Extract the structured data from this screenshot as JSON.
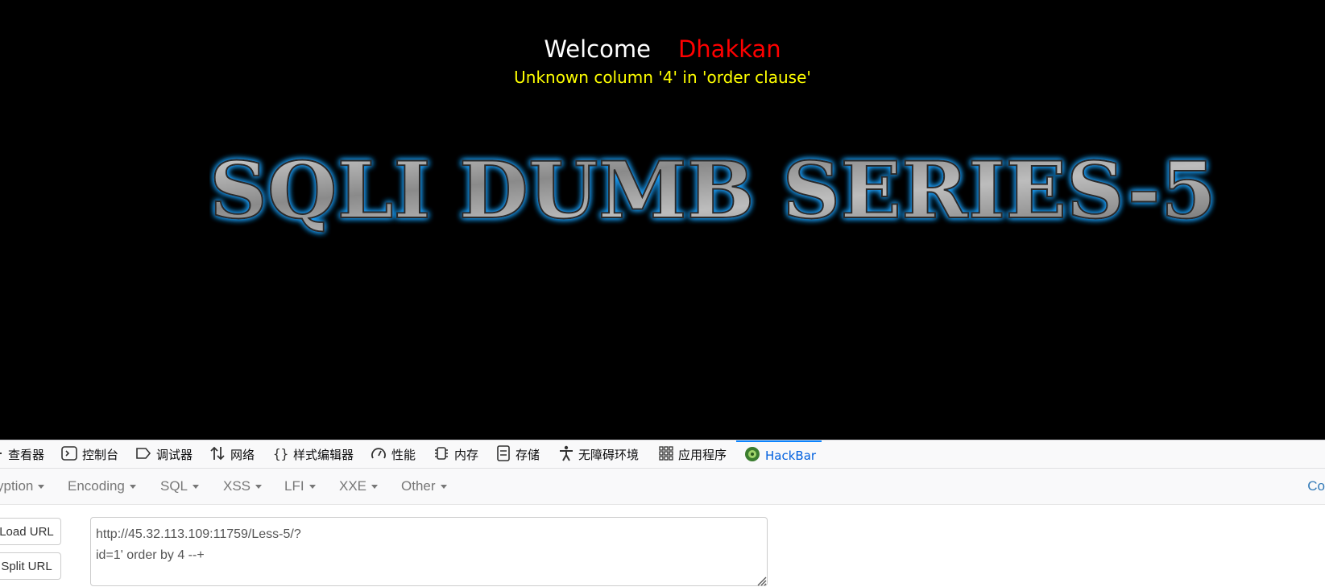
{
  "page": {
    "welcome_label": "Welcome",
    "user_name": "Dhakkan",
    "error_message": "Unknown column '4' in 'order clause'",
    "banner_text": "SQLI DUMB SERIES-5",
    "colors": {
      "welcome": "#ffffff",
      "user": "#ff0000",
      "error": "#ffff00",
      "banner_glow": "#1fa3ff"
    }
  },
  "devtools": {
    "tabs": [
      {
        "label": "查看器",
        "icon": "inspector-icon"
      },
      {
        "label": "控制台",
        "icon": "console-icon"
      },
      {
        "label": "调试器",
        "icon": "debugger-icon"
      },
      {
        "label": "网络",
        "icon": "network-icon"
      },
      {
        "label": "样式编辑器",
        "icon": "style-editor-icon"
      },
      {
        "label": "性能",
        "icon": "performance-icon"
      },
      {
        "label": "内存",
        "icon": "memory-icon"
      },
      {
        "label": "存储",
        "icon": "storage-icon"
      },
      {
        "label": "无障碍环境",
        "icon": "accessibility-icon"
      },
      {
        "label": "应用程序",
        "icon": "application-icon"
      },
      {
        "label": "HackBar",
        "icon": "hackbar-icon",
        "active": true
      }
    ]
  },
  "hackbar": {
    "menus": [
      "yption",
      "Encoding",
      "SQL",
      "XSS",
      "LFI",
      "XXE",
      "Other"
    ],
    "right_link": "Co",
    "load_url_label": "Load URL",
    "split_url_label": "Split URL",
    "url_value": "http://45.32.113.109:11759/Less-5/?\nid=1' order by 4 --+"
  }
}
